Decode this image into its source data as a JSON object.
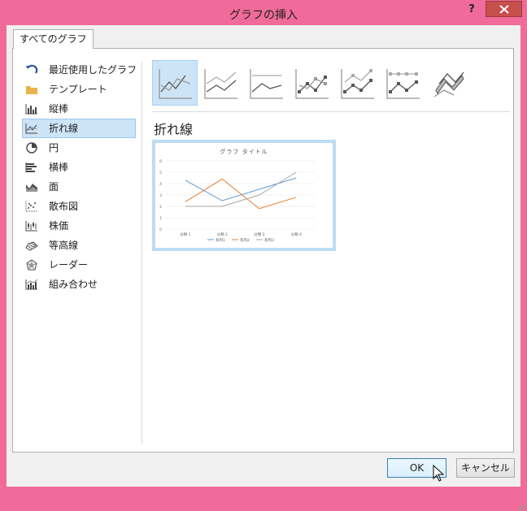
{
  "window": {
    "title": "グラフの挿入",
    "help_label": "?"
  },
  "tabs": [
    {
      "label": "すべてのグラフ"
    }
  ],
  "sidebar": {
    "items": [
      {
        "label": "最近使用したグラフ",
        "icon": "recent-icon"
      },
      {
        "label": "テンプレート",
        "icon": "folder-icon"
      },
      {
        "label": "縦棒",
        "icon": "column-chart-icon"
      },
      {
        "label": "折れ線",
        "icon": "line-chart-icon",
        "selected": true
      },
      {
        "label": "円",
        "icon": "pie-chart-icon"
      },
      {
        "label": "横棒",
        "icon": "bar-chart-icon"
      },
      {
        "label": "面",
        "icon": "area-chart-icon"
      },
      {
        "label": "散布図",
        "icon": "scatter-chart-icon"
      },
      {
        "label": "株価",
        "icon": "stock-chart-icon"
      },
      {
        "label": "等高線",
        "icon": "surface-chart-icon"
      },
      {
        "label": "レーダー",
        "icon": "radar-chart-icon"
      },
      {
        "label": "組み合わせ",
        "icon": "combo-chart-icon"
      }
    ]
  },
  "subtypes": [
    {
      "icon": "line-icon",
      "selected": true
    },
    {
      "icon": "stacked-line-icon"
    },
    {
      "icon": "100-stacked-line-icon"
    },
    {
      "icon": "line-with-markers-icon"
    },
    {
      "icon": "stacked-line-with-markers-icon"
    },
    {
      "icon": "100-stacked-line-with-markers-icon"
    },
    {
      "icon": "3d-line-icon"
    }
  ],
  "section_title": "折れ線",
  "preview": {
    "chart_data": {
      "type": "line",
      "title": "グラフ タイトル",
      "categories": [
        "分類 1",
        "分類 2",
        "分類 3",
        "分類 4"
      ],
      "series": [
        {
          "name": "系列1",
          "values": [
            4.3,
            2.5,
            3.5,
            4.5
          ],
          "color": "#5b9bd5"
        },
        {
          "name": "系列2",
          "values": [
            2.4,
            4.4,
            1.8,
            2.8
          ],
          "color": "#ed7d31"
        },
        {
          "name": "系列3",
          "values": [
            2,
            2,
            3,
            5
          ],
          "color": "#a5a5a5"
        }
      ],
      "ylim": [
        0,
        6
      ],
      "yticks": [
        "0",
        "1",
        "2",
        "3",
        "4",
        "5",
        "6"
      ],
      "grid": true,
      "legend": "bottom"
    }
  },
  "buttons": {
    "ok": "OK",
    "cancel": "キャンセル"
  },
  "colors": {
    "frame": "#f06b99",
    "selection": "#cde4f7",
    "close": "#c7504d"
  }
}
